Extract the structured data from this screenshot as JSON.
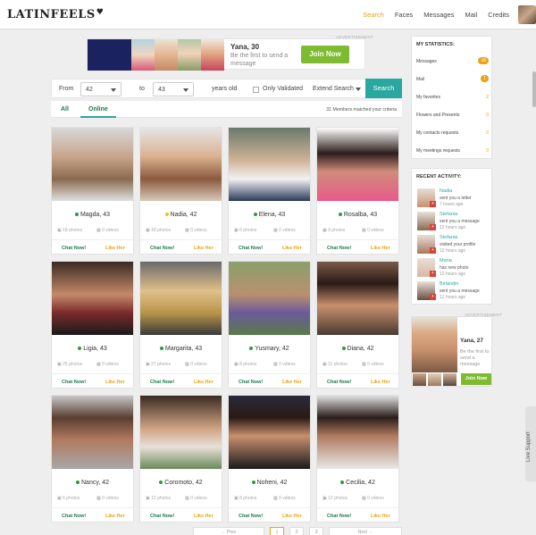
{
  "header": {
    "logo": "LATINFEELS",
    "nav": [
      "Search",
      "Faces",
      "Messages",
      "Mail",
      "Credits"
    ]
  },
  "ad_top": {
    "label": "ADVERTISEMENT",
    "name": "Yana, 30",
    "sub": "Be the first to send a message",
    "join": "Join Now"
  },
  "filter": {
    "from_label": "From",
    "from_value": "42",
    "to_label": "to",
    "to_value": "43",
    "years_label": "years old",
    "only_validated": "Only Validated",
    "extend": "Extend Search",
    "search": "Search"
  },
  "tabs": {
    "all": "All",
    "online": "Online",
    "matched": "31   Members matched your criteria"
  },
  "profiles": [
    {
      "name": "Magda, 43",
      "photos": "18 photos",
      "videos": "0 videos",
      "status": "green"
    },
    {
      "name": "Nadia, 42",
      "photos": "18 photos",
      "videos": "0 videos",
      "status": "yellow"
    },
    {
      "name": "Elena, 43",
      "photos": "6 photos",
      "videos": "0 videos",
      "status": "green"
    },
    {
      "name": "Rosalba, 43",
      "photos": "9 photos",
      "videos": "0 videos",
      "status": "green"
    },
    {
      "name": "Ligia, 43",
      "photos": "25 photos",
      "videos": "0 videos",
      "status": "green"
    },
    {
      "name": "Margarita, 43",
      "photos": "27 photos",
      "videos": "0 videos",
      "status": "green"
    },
    {
      "name": "Yusmary, 42",
      "photos": "8 photos",
      "videos": "0 videos",
      "status": "green"
    },
    {
      "name": "Diana, 42",
      "photos": "11 photos",
      "videos": "0 videos",
      "status": "green"
    },
    {
      "name": "Nancy, 42",
      "photos": "6 photos",
      "videos": "0 videos",
      "status": "green"
    },
    {
      "name": "Coromoto, 42",
      "photos": "12 photos",
      "videos": "0 videos",
      "status": "green"
    },
    {
      "name": "Noheni, 42",
      "photos": "8 photos",
      "videos": "0 videos",
      "status": "green"
    },
    {
      "name": "Cecilia, 42",
      "photos": "12 photos",
      "videos": "0 videos",
      "status": "green"
    }
  ],
  "card_actions": {
    "chat": "Chat Now!",
    "like": "Like Her"
  },
  "pager": {
    "prev": "← Prev",
    "p1": "1",
    "p2": "2",
    "p3": "3",
    "next": "Next →"
  },
  "stats": {
    "title": "MY STATISTICS:",
    "rows": [
      {
        "label": "Messages",
        "value": "18"
      },
      {
        "label": "Mail",
        "value": "1"
      },
      {
        "label": "My favorites",
        "value": "2"
      },
      {
        "label": "Flowers and Presents",
        "value": "0"
      },
      {
        "label": "My contacts requests",
        "value": "0"
      },
      {
        "label": "My meetings requests",
        "value": "0"
      }
    ]
  },
  "activity": {
    "title": "RECENT ACTIVITY:",
    "items": [
      {
        "name": "Nadia",
        "action": "sent you a letter",
        "time": "7 hours ago"
      },
      {
        "name": "Stefania",
        "action": "sent you a message",
        "time": "12 hours ago"
      },
      {
        "name": "Stefania",
        "action": "visited your profile",
        "time": "12 hours ago"
      },
      {
        "name": "Maria",
        "action": "has new photo",
        "time": "12 hours ago"
      },
      {
        "name": "Birlandin",
        "action": "sent you a message",
        "time": "12 hours ago"
      }
    ]
  },
  "ad_side": {
    "label": "ADVERTISEMENT",
    "name": "Yana, 27",
    "sub": "Be the first to send a message",
    "join": "Join Now"
  },
  "live_support": "Live Support"
}
